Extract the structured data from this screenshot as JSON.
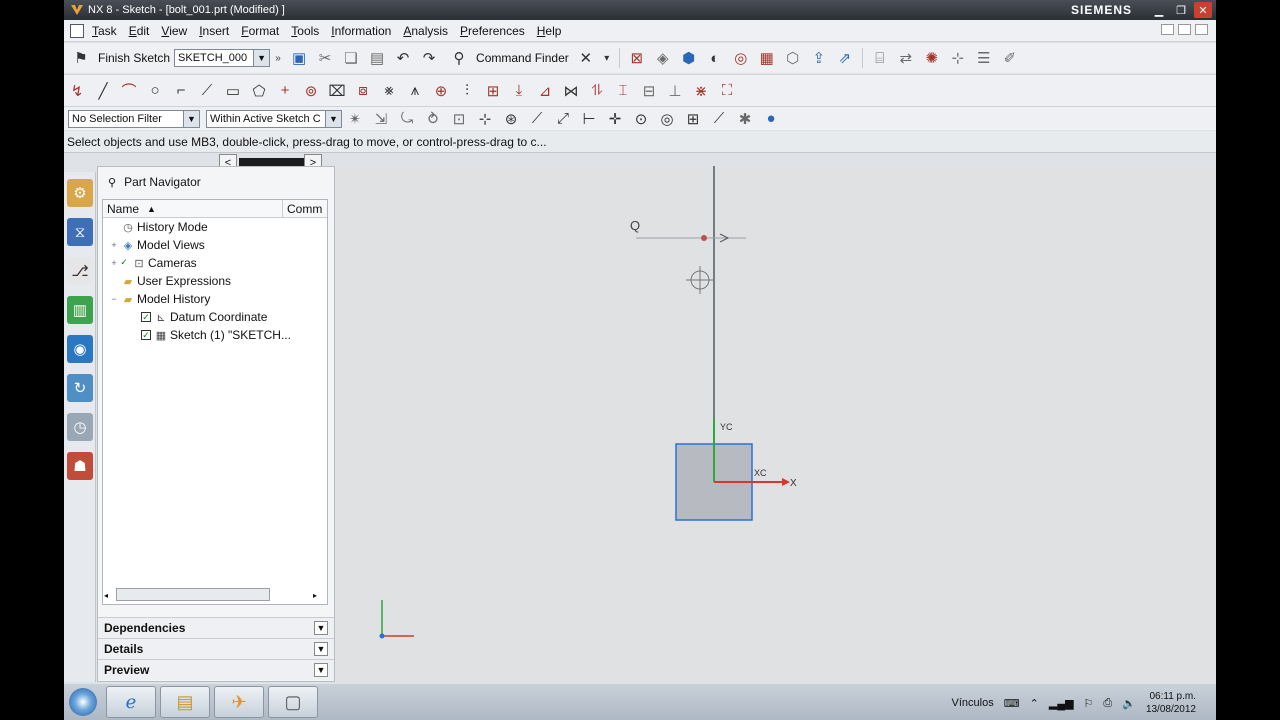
{
  "window": {
    "title": "NX 8 - Sketch - [bolt_001.prt (Modified) ]",
    "brand": "SIEMENS"
  },
  "menu": [
    "Task",
    "Edit",
    "View",
    "Insert",
    "Format",
    "Tools",
    "Information",
    "Analysis",
    "Preferences",
    "Help"
  ],
  "toolbar": {
    "finish_sketch": "Finish Sketch",
    "sketch_name": "SKETCH_000",
    "command_finder": "Command Finder",
    "selection_filter": "No Selection Filter",
    "scope": "Within Active Sketch C"
  },
  "status": {
    "cue": "Select objects and use MB3, double-click, press-drag to move, or control-press-drag to c..."
  },
  "navigator": {
    "title": "Part Navigator",
    "columns": [
      "Name",
      "Comm"
    ],
    "items": [
      {
        "label": "History Mode",
        "icon": "clock-icon",
        "indent": 0,
        "expander": ""
      },
      {
        "label": "Model Views",
        "icon": "views-icon",
        "indent": 0,
        "expander": "+"
      },
      {
        "label": "Cameras",
        "icon": "camera-icon",
        "indent": 0,
        "expander": "+"
      },
      {
        "label": "User Expressions",
        "icon": "folder-icon",
        "indent": 0,
        "expander": ""
      },
      {
        "label": "Model History",
        "icon": "folder-icon",
        "indent": 0,
        "expander": "−"
      },
      {
        "label": "Datum Coordinate",
        "icon": "datum-csys-icon",
        "indent": 1,
        "expander": ""
      },
      {
        "label": "Sketch (1) \"SKETCH...",
        "icon": "sketch-icon",
        "indent": 1,
        "expander": ""
      }
    ],
    "sections": [
      "Dependencies",
      "Details",
      "Preview"
    ]
  },
  "viewport": {
    "origin_label": "Q",
    "y_label": "YC",
    "x_label": "XC",
    "axis_x": "X",
    "sketch_fill": "#b7bbc1",
    "sketch_stroke": "#2f6fd1"
  },
  "taskbar": {
    "language": "Vínculos",
    "time": "06:11 p.m.",
    "date": "13/08/2012"
  }
}
